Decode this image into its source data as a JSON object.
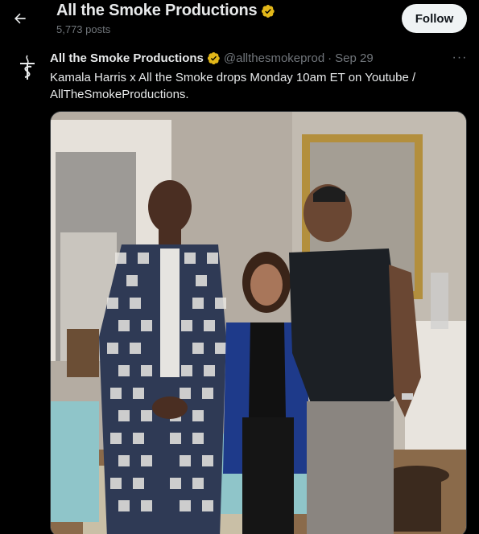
{
  "header": {
    "name": "All the Smoke Productions",
    "posts_count": "5,773 posts",
    "follow_label": "Follow"
  },
  "post": {
    "author": "All the Smoke Productions",
    "handle": "@allthesmokeprod",
    "separator": "·",
    "date": "Sep 29",
    "more": "···",
    "text": "Kamala Harris x All the Smoke drops Monday 10am ET on Youtube / AllTheSmokeProductions."
  },
  "colors": {
    "background": "#000000",
    "text_primary": "#e7e9ea",
    "text_secondary": "#71767b",
    "verified_gold": "#e2b719",
    "follow_bg": "#eff3f4"
  },
  "icons": {
    "back": "arrow-left-icon",
    "verified": "verified-badge-icon",
    "more": "more-horizontal-icon",
    "avatar": "smoke-logo-icon"
  }
}
